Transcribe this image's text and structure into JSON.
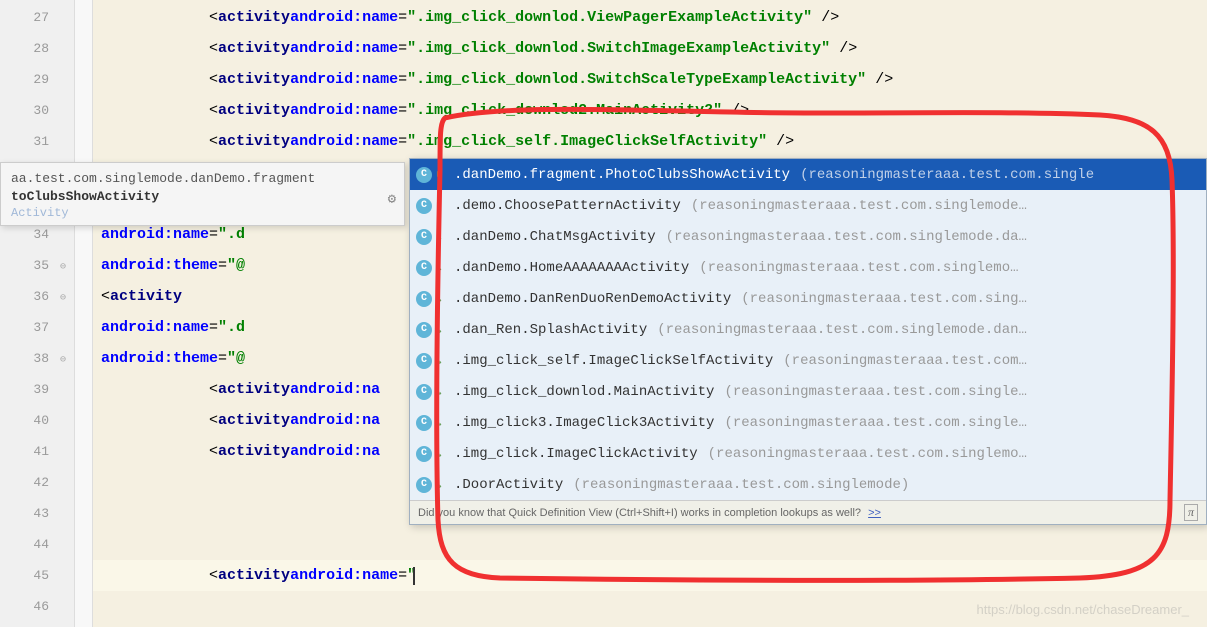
{
  "gutter": {
    "lines": [
      "27",
      "28",
      "29",
      "30",
      "31",
      "",
      "",
      "34",
      "35",
      "36",
      "37",
      "38",
      "39",
      "40",
      "41",
      "42",
      "43",
      "44",
      "45",
      "46"
    ]
  },
  "code": {
    "l27": {
      "indent": "            ",
      "tag": "activity",
      "attr": "android:name",
      "val": "\".img_click_downlod.ViewPagerExampleActivity\"",
      "close": " />"
    },
    "l28": {
      "indent": "            ",
      "tag": "activity",
      "attr": "android:name",
      "val": "\".img_click_downlod.SwitchImageExampleActivity\"",
      "close": " />"
    },
    "l29": {
      "indent": "            ",
      "tag": "activity",
      "attr": "android:name",
      "val": "\".img_click_downlod.SwitchScaleTypeExampleActivity\"",
      "close": " />"
    },
    "l30": {
      "indent": "            ",
      "tag": "activity",
      "attr": "android:name",
      "val": "\".img_click_downlod2.MainActivity2\"",
      "close": " />"
    },
    "l31": {
      "indent": "            ",
      "tag": "activity",
      "attr": "android:name",
      "val": "\".img_click_self.ImageClickSelfActivity\"",
      "close": " />"
    },
    "l34_attr": "android:name",
    "l34_val": "\".d",
    "l35_attr": "android:theme",
    "l35_val": "\"@",
    "l36_tag": "activity",
    "l37_attr": "android:name",
    "l37_val": "\".d",
    "l38_attr": "android:theme",
    "l38_val": "\"@",
    "l39": {
      "indent": "            ",
      "tag": "activity",
      "attr": "android:na"
    },
    "l40": {
      "indent": "            ",
      "tag": "activity",
      "attr": "android:na"
    },
    "l41": {
      "indent": "            ",
      "tag": "activity",
      "attr": "android:na"
    },
    "l45": {
      "indent": "            ",
      "tag": "activity",
      "attr": "android:name",
      "val": "\""
    }
  },
  "tooltip": {
    "line1": "aa.test.com.singlemode.danDemo.fragment",
    "line2": "toClubsShowActivity",
    "line3": "Activity"
  },
  "completion": {
    "items": [
      {
        "text": ".danDemo.fragment.PhotoClubsShowActivity",
        "hint": "(reasoningmasteraaa.test.com.single",
        "selected": true
      },
      {
        "text": ".demo.ChoosePatternActivity",
        "hint": "(reasoningmasteraaa.test.com.singlemode…"
      },
      {
        "text": ".danDemo.ChatMsgActivity",
        "hint": "(reasoningmasteraaa.test.com.singlemode.da…"
      },
      {
        "text": ".danDemo.HomeAAAAAAAActivity",
        "hint": "(reasoningmasteraaa.test.com.singlemo…"
      },
      {
        "text": ".danDemo.DanRenDuoRenDemoActivity",
        "hint": "(reasoningmasteraaa.test.com.sing…"
      },
      {
        "text": ".dan_Ren.SplashActivity",
        "hint": "(reasoningmasteraaa.test.com.singlemode.dan…"
      },
      {
        "text": ".img_click_self.ImageClickSelfActivity",
        "hint": "(reasoningmasteraaa.test.com…"
      },
      {
        "text": ".img_click_downlod.MainActivity",
        "hint": "(reasoningmasteraaa.test.com.single…"
      },
      {
        "text": ".img_click3.ImageClick3Activity",
        "hint": "(reasoningmasteraaa.test.com.single…"
      },
      {
        "text": ".img_click.ImageClickActivity",
        "hint": "(reasoningmasteraaa.test.com.singlemo…"
      },
      {
        "text": ".DoorActivity",
        "hint": "(reasoningmasteraaa.test.com.singlemode)"
      }
    ],
    "tip_text": "Did you know that Quick Definition View (Ctrl+Shift+I) works in completion lookups as well?",
    "tip_link": ">>"
  },
  "watermark": "https://blog.csdn.net/chaseDreamer_"
}
